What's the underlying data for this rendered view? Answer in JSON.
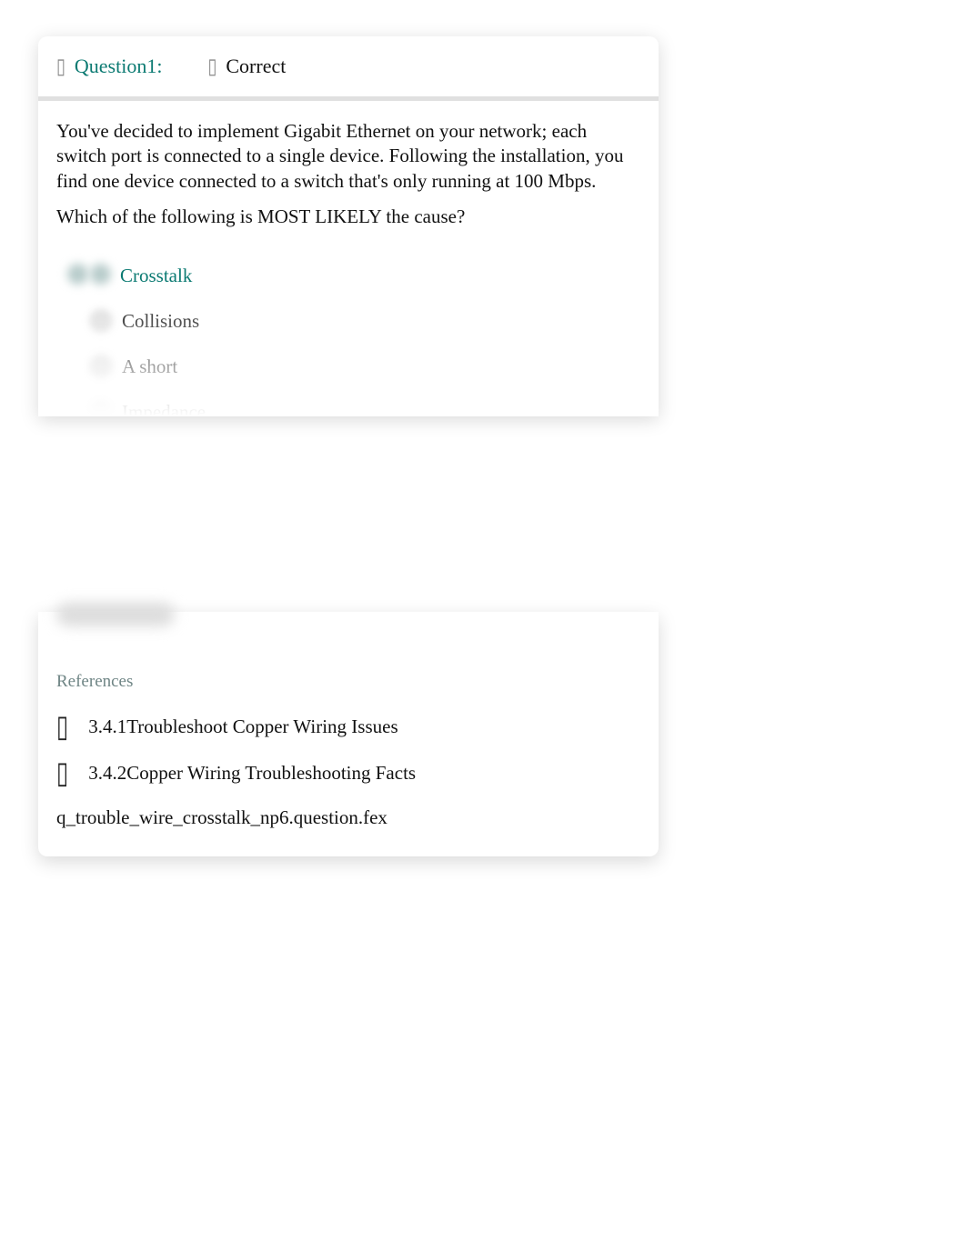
{
  "header": {
    "question_label": "Question1:",
    "status_label": "Correct"
  },
  "question": {
    "paragraph1": "You've decided to implement Gigabit Ethernet on your network; each switch port is connected to a single device. Following the installation, you find one device connected to a switch that's only running at 100 Mbps.",
    "paragraph2": "Which of the following is MOST LIKELY the cause?"
  },
  "answers": [
    {
      "text": "Crosstalk",
      "correct": true
    },
    {
      "text": "Collisions",
      "correct": false
    },
    {
      "text": "A short",
      "correct": false
    },
    {
      "text": "Impedance",
      "correct": false
    }
  ],
  "references": {
    "title": "References",
    "items": [
      {
        "number": "3.4.1",
        "title": "Troubleshoot Copper Wiring Issues"
      },
      {
        "number": "3.4.2",
        "title": "Copper Wiring Troubleshooting Facts"
      }
    ],
    "file_id": "q_trouble_wire_crosstalk_np6.question.fex"
  }
}
